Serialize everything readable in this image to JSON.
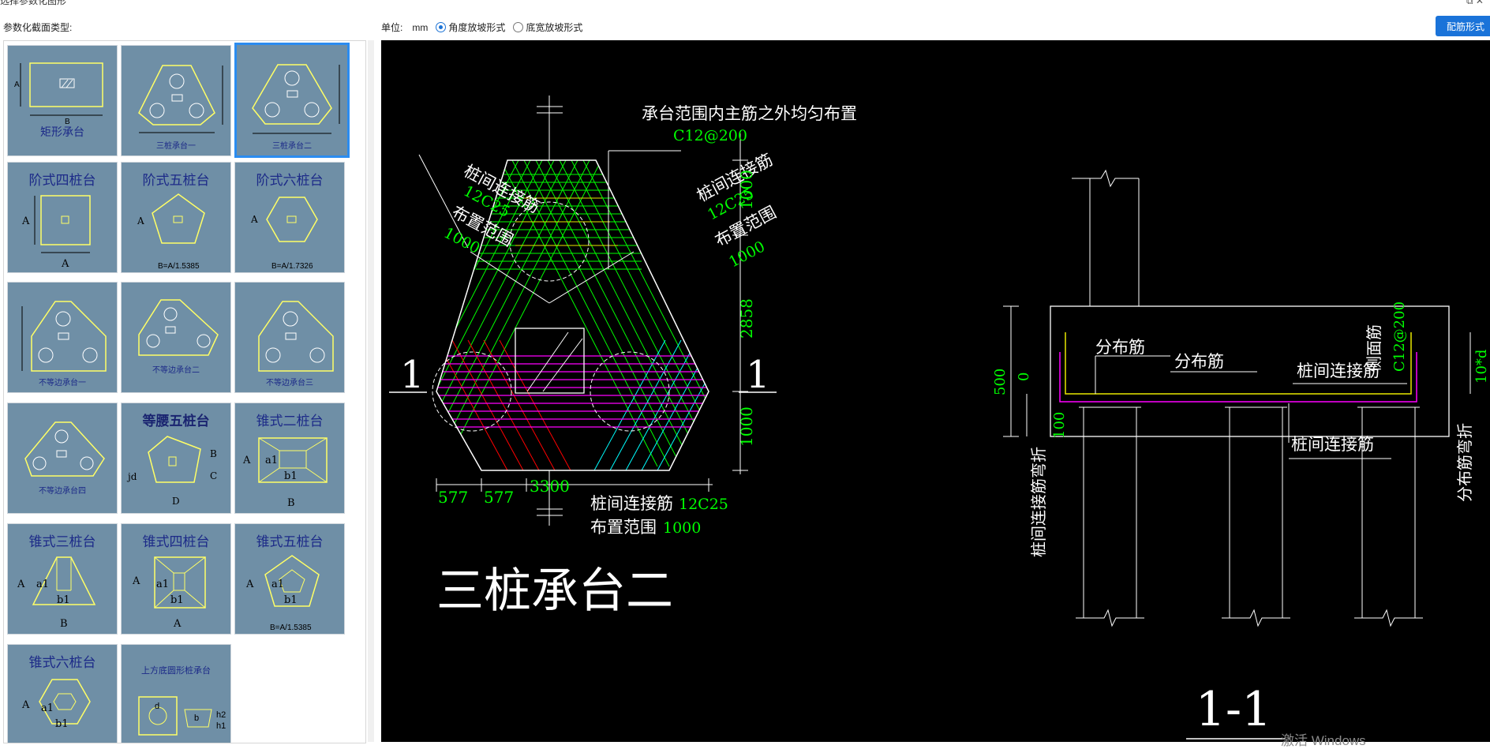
{
  "window": {
    "title": "选择参数化图形"
  },
  "toolbar": {
    "section_type_label": "参数化截面类型:",
    "unit_label": "单位:",
    "unit_value": "mm",
    "slope_option_angle": "角度放坡形式",
    "slope_option_width": "底宽放坡形式",
    "rebar_button": "配筋形式"
  },
  "gallery": {
    "tiles": [
      {
        "label": "矩形承台"
      },
      {
        "label": "三桩承台一"
      },
      {
        "label": "三桩承台二"
      },
      {
        "label": "阶式四桩台",
        "dim_a": "A",
        "dim_b": "A"
      },
      {
        "label": "阶式五桩台",
        "dim_a": "A",
        "dim_b": "B=A/1.5385"
      },
      {
        "label": "阶式六桩台",
        "dim_a": "A",
        "dim_b": "B=A/1.7326"
      },
      {
        "label": "不等边承台一"
      },
      {
        "label": "不等边承台二"
      },
      {
        "label": "不等边承台三"
      },
      {
        "label": "不等边承台四"
      },
      {
        "label": "等腰五桩台",
        "dim_b": "B",
        "dim_c": "C",
        "dim_d": "D",
        "dim_jd": "jd"
      },
      {
        "label": "锥式二桩台",
        "dim_a": "A",
        "dim_a1": "a1",
        "dim_b1": "b1",
        "dim_b": "B"
      },
      {
        "label": "锥式三桩台",
        "dim_a": "A",
        "dim_a1": "a1",
        "dim_b1": "b1",
        "dim_b": "B"
      },
      {
        "label": "锥式四桩台",
        "dim_a": "A",
        "dim_a1": "a1",
        "dim_b1": "b1",
        "dim_b": "A"
      },
      {
        "label": "锥式五桩台",
        "dim_a": "A",
        "dim_a1": "a1",
        "dim_b1": "b1",
        "dim_b": "B=A/1.5385"
      },
      {
        "label": "锥式六桩台",
        "dim_a": "A",
        "dim_a1": "a1",
        "dim_b1": "b1"
      },
      {
        "label": "上方底圆形桩承台",
        "dim_d": "d",
        "dim_b": "b",
        "dim_h1": "h1",
        "dim_h2": "h2"
      }
    ],
    "tile0_dims": {
      "a": "A",
      "b": "B"
    }
  },
  "drawing": {
    "plan_title": "三桩承台二",
    "section_title": "1-1",
    "section_mark": "1",
    "top_note": "承台范围内主筋之外均匀布置",
    "top_rebar": "C12@200",
    "left_conn_label": "桩间连接筋",
    "left_conn_rebar": "12C25",
    "left_range_label": "布置范围",
    "left_range_value": "1000",
    "right_conn_label": "桩间连接筋",
    "right_conn_rebar": "12C25",
    "right_range_label": "布置范围",
    "right_range_value": "1000",
    "dim_right": [
      "1000",
      "2858",
      "1000"
    ],
    "dim_bottom_left": "577",
    "dim_bottom_left2": "577",
    "dim_bottom_total": "3300",
    "bottom_conn_label": "桩间连接筋",
    "bottom_conn_rebar": "12C25",
    "bottom_range_label": "布置范围",
    "bottom_range_value": "1000",
    "sec_dim_500": "500",
    "sec_dim_0": "0",
    "sec_dim_100": "100",
    "sec_dist1": "分布筋",
    "sec_dist2": "分布筋",
    "sec_side_label": "侧面筋",
    "sec_side_rebar": "C12@200",
    "sec_conn_top": "桩间连接筋",
    "sec_conn_bottom": "桩间连接筋",
    "sec_left_vertical": "桩间连接筋弯折",
    "sec_right_vertical": "分布筋弯折",
    "sec_right_10d": "10*d"
  },
  "system": {
    "watermark": "激活 Windows"
  },
  "colors": {
    "accent": "#1a73d9",
    "tile_bg": "#6f8fa6",
    "cad_bg": "#000000",
    "cad_green": "#00ff00",
    "cad_yellow": "#e8e800",
    "cad_magenta": "#ff00ff"
  }
}
